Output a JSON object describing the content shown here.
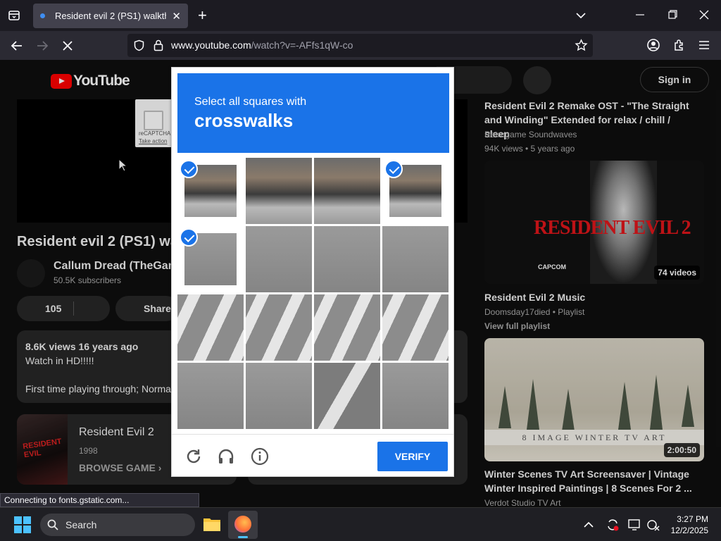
{
  "browser": {
    "tab_title": "Resident evil 2 (PS1) walkthroug",
    "url_host": "www.youtube.com",
    "url_path": "/watch?v=-AFfs1qW-co",
    "status_text": "Connecting to fonts.gstatic.com..."
  },
  "youtube": {
    "logo_text": "YouTube",
    "sign_in": "Sign in",
    "video_title": "Resident evil 2 (PS1) wa",
    "channel_name": "Callum Dread (TheGam",
    "channel_subs": "50.5K subscribers",
    "likes": "105",
    "share": "Share",
    "desc_meta": "8.6K views  16 years ago",
    "desc_line1": "Watch in HD!!!!!",
    "desc_line2": "First time playing through; Norma",
    "game_card": {
      "title": "Resident Evil 2",
      "year": "1998",
      "browse": "BROWSE GAME",
      "art_label": "RESIDENT EVIL"
    },
    "small_recaptcha": {
      "label": "reCAPTCHA",
      "action": "Take action"
    }
  },
  "sidebar": {
    "item1": {
      "title_line1": "Resident Evil 2 Remake OST - \"The Straight",
      "title_line2": "and Winding\" Extended for relax / chill / sleep",
      "channel": "Retrogame Soundwaves",
      "meta": "94K views • 5 years ago"
    },
    "item2": {
      "thumb_title": "RESIDENT EVIL 2",
      "thumb_brand": "CAPCOM",
      "badge": "74 videos",
      "title": "Resident Evil 2 Music",
      "channel": "Doomsday17died • Playlist",
      "link": "View full playlist"
    },
    "item3": {
      "thumb_text": "8 IMAGE WINTER TV ART",
      "duration": "2:00:50",
      "title_line1": "Winter Scenes TV Art Screensaver | Vintage",
      "title_line2": "Winter Inspired Paintings | 8 Scenes For 2 ...",
      "channel": "Verdot Studio TV Art"
    }
  },
  "captcha": {
    "instruction": "Select all squares with",
    "target": "crosswalks",
    "verify": "VERIFY",
    "selected_tiles": [
      0,
      3,
      4
    ]
  },
  "taskbar": {
    "search": "Search",
    "time": "3:27 PM",
    "date": "12/2/2025"
  }
}
